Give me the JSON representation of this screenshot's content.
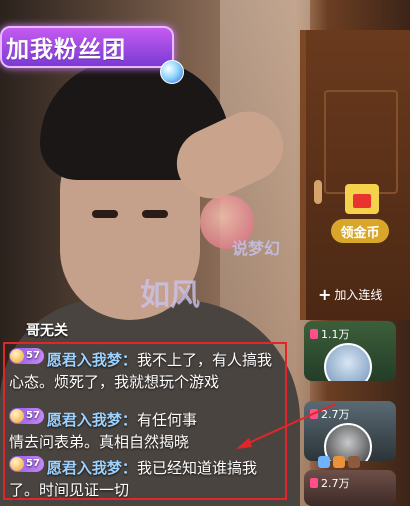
{
  "banner": {
    "title": "加我粉丝团",
    "icon": "disco-ball-icon"
  },
  "gold": {
    "label": "领金币",
    "icon": "gift-box-icon"
  },
  "link": {
    "label": "加入连线",
    "icon": "plus-icon"
  },
  "watermark": {
    "text_main": "如风",
    "text_side": "说梦幻"
  },
  "anchor_name": "哥无关",
  "chat": [
    {
      "level": "57",
      "user": "愿君入我梦：",
      "text": "我不上了，有人搞我心态。烦死了，我就想玩个游戏"
    },
    {
      "level": "57",
      "user": "愿君入我梦：",
      "text": "有任何事情去问表弟。真相自然揭晓"
    },
    {
      "level": "57",
      "user": "愿君入我梦：",
      "text": "我已经知道谁搞我了。时间见证一切"
    }
  ],
  "viewers": [
    {
      "count": "1.1万"
    },
    {
      "count": "2.7万"
    },
    {
      "count": "2.7万"
    }
  ],
  "colors": {
    "highlight": "#e0262b",
    "username": "#9cd2ff",
    "badge": "#8a55ea",
    "gold_btn": "#d8a628"
  }
}
